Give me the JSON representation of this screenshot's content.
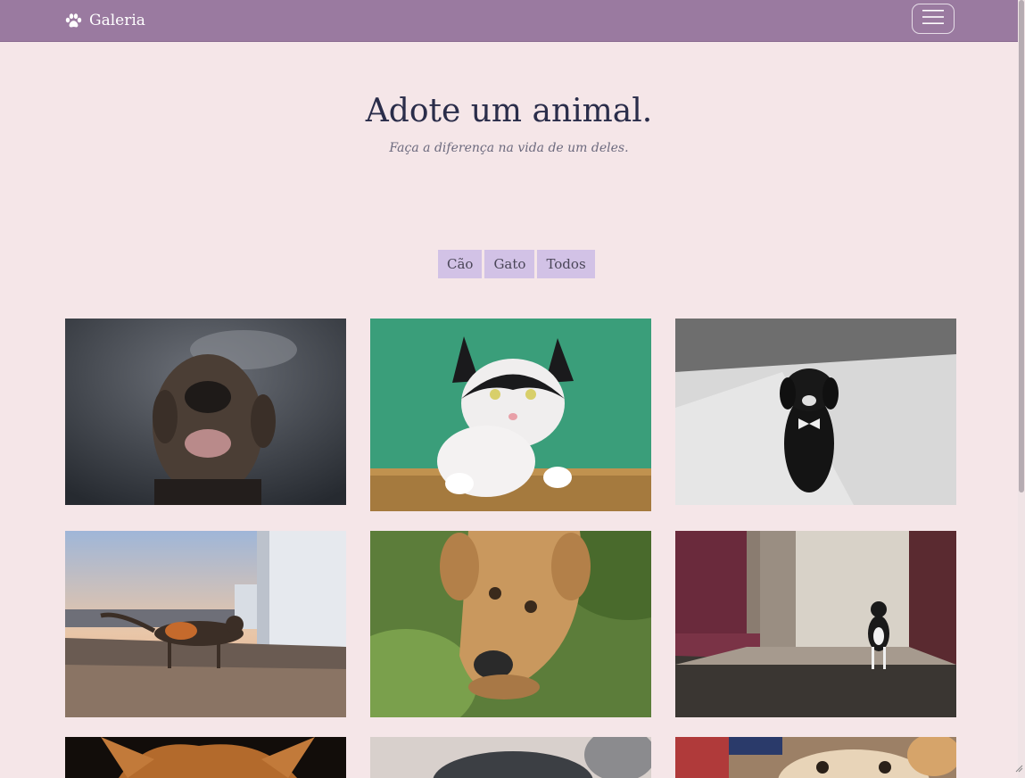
{
  "navbar": {
    "brand_label": "Galeria",
    "brand_icon": "paw-icon",
    "menu_icon": "hamburger-icon"
  },
  "hero": {
    "title": "Adote um animal.",
    "subtitle": "Faça a diferença na vida de um deles."
  },
  "filters": [
    {
      "label": "Cão"
    },
    {
      "label": "Gato"
    },
    {
      "label": "Todos"
    }
  ],
  "gallery": [
    {
      "kind": "dog",
      "subject": "brindle dog smiling"
    },
    {
      "kind": "cat",
      "subject": "black and white cat on green wall"
    },
    {
      "kind": "dog",
      "subject": "black puppy with bow tie"
    },
    {
      "kind": "cat",
      "subject": "calico cat at sunset"
    },
    {
      "kind": "dog",
      "subject": "tan dog looking up"
    },
    {
      "kind": "cat",
      "subject": "black and white cat in doorway"
    },
    {
      "kind": "cat",
      "subject": "orange kitten"
    },
    {
      "kind": "dog",
      "subject": "grey dog"
    },
    {
      "kind": "dog",
      "subject": "light puppy"
    }
  ],
  "colors": {
    "navbar": "#9a7aa0",
    "background": "#f5e6e8",
    "filter_button": "#d2c2e6",
    "title": "#2a2d4a"
  }
}
